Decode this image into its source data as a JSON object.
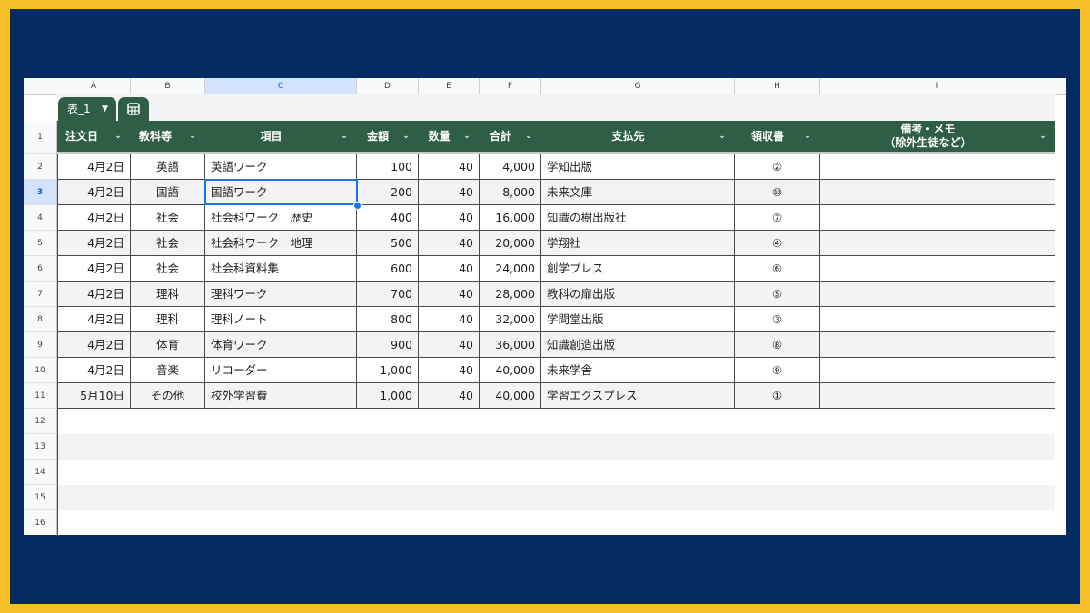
{
  "columns": [
    "A",
    "B",
    "C",
    "D",
    "E",
    "F",
    "G",
    "H",
    "I"
  ],
  "selected_column": "C",
  "selected_row": "3",
  "table_tab": {
    "name": "表_1"
  },
  "headers": [
    "注文日",
    "教科等",
    "項目",
    "金額",
    "数量",
    "合計",
    "支払先",
    "領収書",
    "備考・メモ\n（除外生徒など）"
  ],
  "row_numbers": [
    "1",
    "2",
    "3",
    "4",
    "5",
    "6",
    "7",
    "8",
    "9",
    "10",
    "11",
    "12",
    "13",
    "14",
    "15",
    "16"
  ],
  "rows": [
    [
      "4月2日",
      "英語",
      "英語ワーク",
      "100",
      "40",
      "4,000",
      "学知出版",
      "②",
      ""
    ],
    [
      "4月2日",
      "国語",
      "国語ワーク",
      "200",
      "40",
      "8,000",
      "未来文庫",
      "⑩",
      ""
    ],
    [
      "4月2日",
      "社会",
      "社会科ワーク　歴史",
      "400",
      "40",
      "16,000",
      "知識の樹出版社",
      "⑦",
      ""
    ],
    [
      "4月2日",
      "社会",
      "社会科ワーク　地理",
      "500",
      "40",
      "20,000",
      "学翔社",
      "④",
      ""
    ],
    [
      "4月2日",
      "社会",
      "社会科資料集",
      "600",
      "40",
      "24,000",
      "創学プレス",
      "⑥",
      ""
    ],
    [
      "4月2日",
      "理科",
      "理科ワーク",
      "700",
      "40",
      "28,000",
      "教科の扉出版",
      "⑤",
      ""
    ],
    [
      "4月2日",
      "理科",
      "理科ノート",
      "800",
      "40",
      "32,000",
      "学問堂出版",
      "③",
      ""
    ],
    [
      "4月2日",
      "体育",
      "体育ワーク",
      "900",
      "40",
      "36,000",
      "知識創造出版",
      "⑧",
      ""
    ],
    [
      "4月2日",
      "音楽",
      "リコーダー",
      "1,000",
      "40",
      "40,000",
      "未来学舎",
      "⑨",
      ""
    ],
    [
      "5月10日",
      "その他",
      "校外学習費",
      "1,000",
      "40",
      "40,000",
      "学習エクスプレス",
      "①",
      ""
    ]
  ],
  "colors": {
    "header": "#2E5E45",
    "selection": "#1A73E8",
    "frame": "#062B63",
    "border": "#F5C027"
  },
  "icons": {
    "dropdown": "chevron-down-icon",
    "table_view": "table-grid-icon"
  }
}
